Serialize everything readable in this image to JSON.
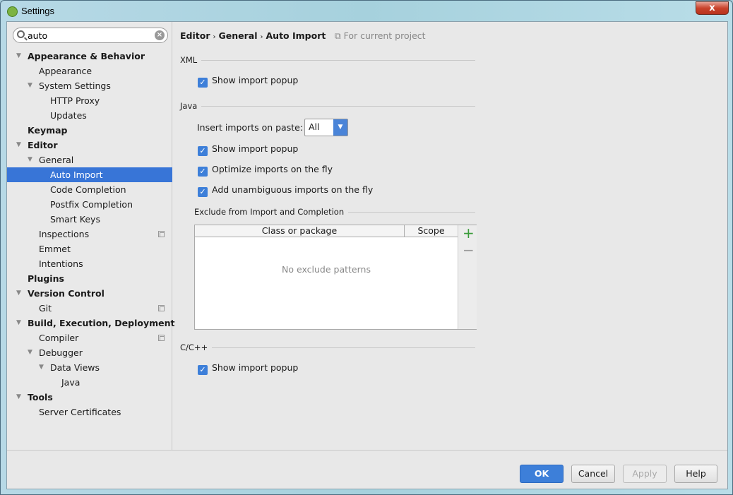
{
  "window": {
    "title": "Settings",
    "close_label": "x"
  },
  "search": {
    "value": "auto"
  },
  "tree": [
    {
      "label": "Appearance & Behavior",
      "level": 0,
      "bold": true,
      "arrow": true
    },
    {
      "label": "Appearance",
      "level": 1
    },
    {
      "label": "System Settings",
      "level": 1,
      "arrow": true
    },
    {
      "label": "HTTP Proxy",
      "level": 2
    },
    {
      "label": "Updates",
      "level": 2
    },
    {
      "label": "Keymap",
      "level": 0,
      "bold": true
    },
    {
      "label": "Editor",
      "level": 0,
      "bold": true,
      "arrow": true
    },
    {
      "label": "General",
      "level": 1,
      "arrow": true
    },
    {
      "label": "Auto Import",
      "level": 2,
      "selected": true
    },
    {
      "label": "Code Completion",
      "level": 2
    },
    {
      "label": "Postfix Completion",
      "level": 2
    },
    {
      "label": "Smart Keys",
      "level": 2
    },
    {
      "label": "Inspections",
      "level": 1,
      "project": true
    },
    {
      "label": "Emmet",
      "level": 1
    },
    {
      "label": "Intentions",
      "level": 1
    },
    {
      "label": "Plugins",
      "level": 0,
      "bold": true
    },
    {
      "label": "Version Control",
      "level": 0,
      "bold": true,
      "arrow": true
    },
    {
      "label": "Git",
      "level": 1,
      "project": true
    },
    {
      "label": "Build, Execution, Deployment",
      "level": 0,
      "bold": true,
      "arrow": true
    },
    {
      "label": "Compiler",
      "level": 1,
      "project": true
    },
    {
      "label": "Debugger",
      "level": 1,
      "arrow": true
    },
    {
      "label": "Data Views",
      "level": 2,
      "arrow": true
    },
    {
      "label": "Java",
      "level": 3
    },
    {
      "label": "Tools",
      "level": 0,
      "bold": true,
      "arrow": true
    },
    {
      "label": "Server Certificates",
      "level": 1
    }
  ],
  "breadcrumb": {
    "items": [
      "Editor",
      "General",
      "Auto Import"
    ],
    "scope": "For current project"
  },
  "xml": {
    "title": "XML",
    "show_popup": "Show import popup"
  },
  "java": {
    "title": "Java",
    "paste_label": "Insert imports on paste:",
    "paste_value": "All",
    "show_popup": "Show import popup",
    "optimize": "Optimize imports on the fly",
    "unambiguous": "Add unambiguous imports on the fly",
    "exclude_title": "Exclude from Import and Completion",
    "col_class": "Class or package",
    "col_scope": "Scope",
    "empty": "No exclude patterns"
  },
  "cpp": {
    "title": "C/C++",
    "show_popup": "Show import popup"
  },
  "buttons": {
    "ok": "OK",
    "cancel": "Cancel",
    "apply": "Apply",
    "help": "Help"
  },
  "colors": {
    "accent": "#3875d7",
    "checkbox": "#3d7fd9"
  }
}
